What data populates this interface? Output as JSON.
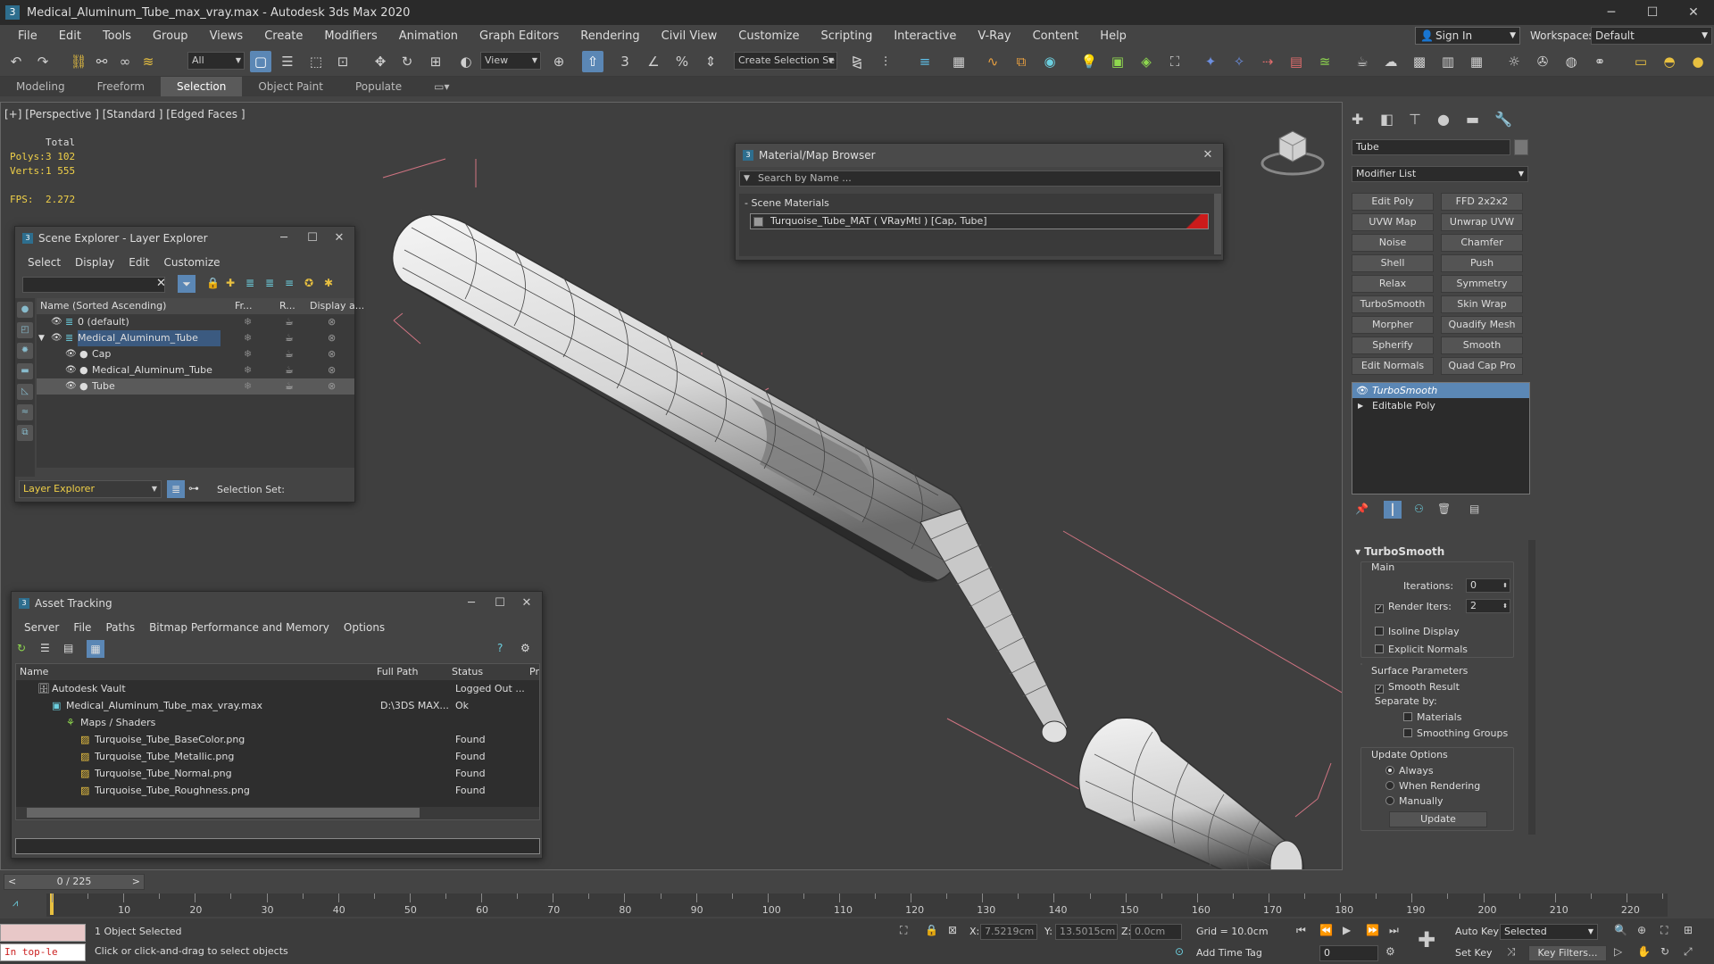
{
  "window": {
    "title": "Medical_Aluminum_Tube_max_vray.max - Autodesk 3ds Max 2020",
    "app_icon": "3"
  },
  "menu": [
    "File",
    "Edit",
    "Tools",
    "Group",
    "Views",
    "Create",
    "Modifiers",
    "Animation",
    "Graph Editors",
    "Rendering",
    "Civil View",
    "Customize",
    "Scripting",
    "Interactive",
    "V-Ray",
    "Content",
    "Help"
  ],
  "account": {
    "sign_in": "Sign In",
    "workspaces_label": "Workspaces:",
    "workspace": "Default"
  },
  "toolbar": {
    "filter": "All",
    "ref_coord": "View",
    "selection_set": "Create Selection Se"
  },
  "ribbon_tabs": [
    "Modeling",
    "Freeform",
    "Selection",
    "Object Paint",
    "Populate"
  ],
  "viewport": {
    "label": "[+] [Perspective ] [Standard ] [Edged Faces ]",
    "stats": {
      "total": "Total",
      "polys_label": "Polys:",
      "polys": "3 102",
      "verts_label": "Verts:",
      "verts": "1 555",
      "fps_label": "FPS:",
      "fps": "2.272"
    }
  },
  "scene_explorer": {
    "title": "Scene Explorer - Layer Explorer",
    "menu": [
      "Select",
      "Display",
      "Edit",
      "Customize"
    ],
    "columns": [
      "Name (Sorted Ascending)",
      "Fr...",
      "R...",
      "Display a..."
    ],
    "rows": [
      {
        "name": "0 (default)",
        "indent": 0
      },
      {
        "name": "Medical_Aluminum_Tube",
        "indent": 0,
        "expanded": true
      },
      {
        "name": "Cap",
        "indent": 1
      },
      {
        "name": "Medical_Aluminum_Tube",
        "indent": 1
      },
      {
        "name": "Tube",
        "indent": 1,
        "selected": true
      }
    ],
    "footer_layer": "Layer Explorer",
    "footer_selset": "Selection Set:"
  },
  "material_browser": {
    "title": "Material/Map Browser",
    "search_placeholder": "Search by Name ...",
    "group": "- Scene Materials",
    "item": "Turquoise_Tube_MAT ( VRayMtl ) [Cap, Tube]",
    "swatch_color": "#cc1b1b"
  },
  "asset_tracking": {
    "title": "Asset Tracking",
    "menu": [
      "Server",
      "File",
      "Paths",
      "Bitmap Performance and Memory",
      "Options"
    ],
    "columns": [
      "Name",
      "Full Path",
      "Status",
      "Pr"
    ],
    "rows": [
      {
        "name": "Autodesk Vault",
        "path": "",
        "status": "Logged Out ...",
        "indent": 1
      },
      {
        "name": "Medical_Aluminum_Tube_max_vray.max",
        "path": "D:\\3DS MAX...",
        "status": "Ok",
        "indent": 2
      },
      {
        "name": "Maps / Shaders",
        "path": "",
        "status": "",
        "indent": 3
      },
      {
        "name": "Turquoise_Tube_BaseColor.png",
        "path": "",
        "status": "Found",
        "indent": 4
      },
      {
        "name": "Turquoise_Tube_Metallic.png",
        "path": "",
        "status": "Found",
        "indent": 4
      },
      {
        "name": "Turquoise_Tube_Normal.png",
        "path": "",
        "status": "Found",
        "indent": 4
      },
      {
        "name": "Turquoise_Tube_Roughness.png",
        "path": "",
        "status": "Found",
        "indent": 4
      }
    ]
  },
  "command_panel": {
    "object_name": "Tube",
    "modifier_list": "Modifier List",
    "modifier_buttons": [
      "Edit Poly",
      "FFD 2x2x2",
      "UVW Map",
      "Unwrap UVW",
      "Noise",
      "Chamfer",
      "Shell",
      "Push",
      "Relax",
      "Symmetry",
      "TurboSmooth",
      "Skin Wrap",
      "Morpher",
      "Quadify Mesh",
      "Spherify",
      "Smooth",
      "Edit Normals",
      "Quad Cap Pro"
    ],
    "stack": [
      "TurboSmooth",
      "Editable Poly"
    ],
    "turbosmooth": {
      "title": "TurboSmooth",
      "main": "Main",
      "iterations_label": "Iterations:",
      "iterations": "0",
      "render_iters_label": "Render Iters:",
      "render_iters": "2",
      "isoline": "Isoline Display",
      "explicit": "Explicit Normals",
      "surface_params": "Surface Parameters",
      "smooth_result": "Smooth Result",
      "separate_by": "Separate by:",
      "materials": "Materials",
      "smoothing_groups": "Smoothing Groups",
      "update_options": "Update Options",
      "always": "Always",
      "when_rendering": "When Rendering",
      "manually": "Manually",
      "update": "Update"
    }
  },
  "timeline": {
    "frame": "0 / 225",
    "ticks": [
      "10",
      "20",
      "30",
      "40",
      "50",
      "60",
      "70",
      "80",
      "90",
      "100",
      "110",
      "120",
      "130",
      "140",
      "150",
      "160",
      "170",
      "180",
      "190",
      "200",
      "210",
      "220"
    ]
  },
  "status": {
    "script": "In top-le",
    "selected": "1 Object Selected",
    "prompt": "Click or click-and-drag to select objects",
    "x_label": "X:",
    "x": "7.5219cm",
    "y_label": "Y:",
    "y": "13.5015cm",
    "z_label": "Z:",
    "z": "0.0cm",
    "grid": "Grid = 10.0cm",
    "add_time_tag": "Add Time Tag",
    "auto_key": "Auto Key",
    "set_key": "Set Key",
    "key_mode": "Selected",
    "key_filters": "Key Filters...",
    "frame_field": "0"
  }
}
